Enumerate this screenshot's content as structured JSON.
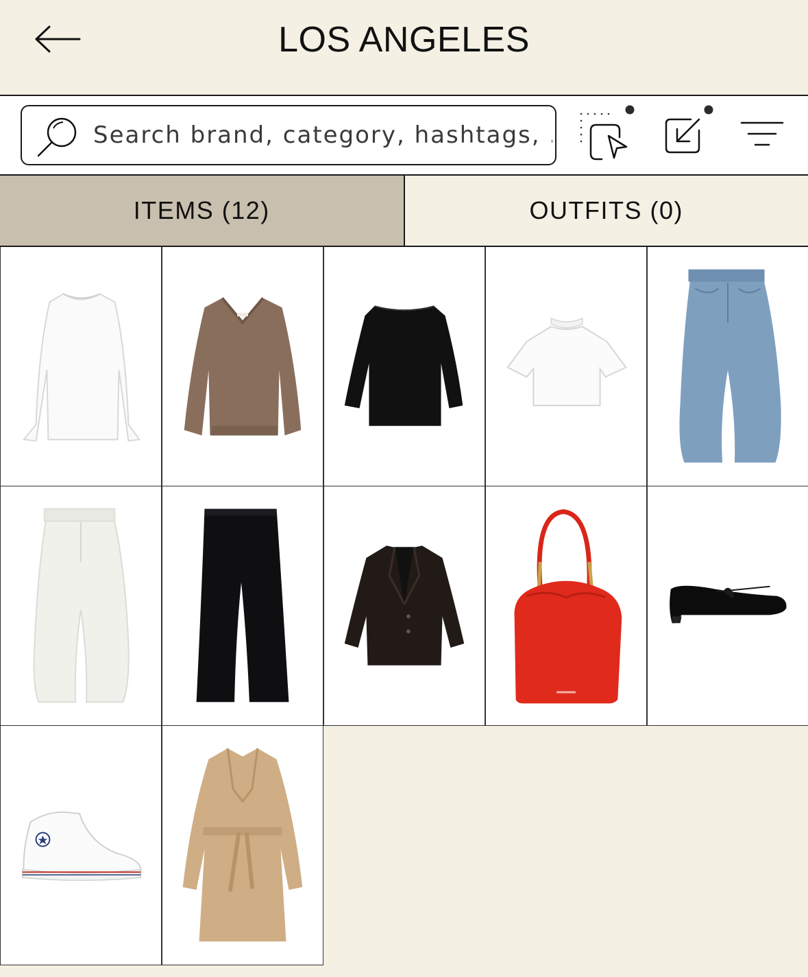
{
  "header": {
    "title": "LOS ANGELES",
    "back_icon": "arrow-left-icon"
  },
  "search": {
    "placeholder": "Search brand, category, hashtags, ..."
  },
  "toolbar": {
    "icons": [
      "select-cursor-icon",
      "share-export-icon",
      "filter-lines-icon"
    ]
  },
  "tabs": [
    {
      "label": "ITEMS (12)",
      "active": true
    },
    {
      "label": "OUTFITS (0)",
      "active": false
    }
  ],
  "items": [
    {
      "type": "white-long-sleeve-top"
    },
    {
      "type": "brown-v-neck-sweater"
    },
    {
      "type": "black-boat-neck-top"
    },
    {
      "type": "white-cropped-tee"
    },
    {
      "type": "blue-barrel-jeans"
    },
    {
      "type": "white-barrel-jeans"
    },
    {
      "type": "black-wide-trousers"
    },
    {
      "type": "black-blazer"
    },
    {
      "type": "red-leather-bag"
    },
    {
      "type": "black-ballet-flat"
    },
    {
      "type": "white-high-top-sneaker"
    },
    {
      "type": "beige-trench-coat"
    }
  ],
  "colors": {
    "background": "#f4f0e4",
    "active_tab": "#c9bfae",
    "border": "#1a1a1a"
  }
}
